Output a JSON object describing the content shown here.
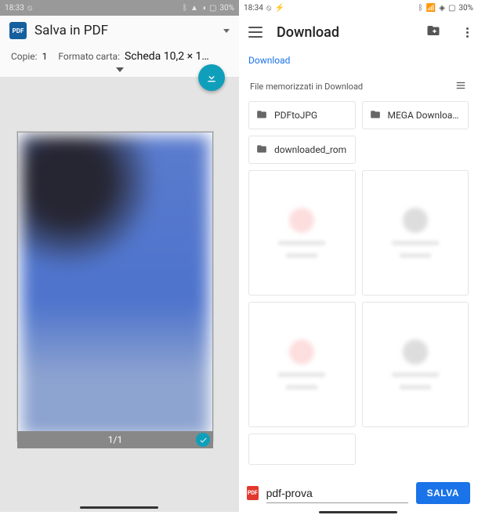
{
  "left": {
    "status": {
      "time": "18:33",
      "battery": "30%"
    },
    "header": {
      "badge": "PDF",
      "title": "Salva in PDF"
    },
    "options": {
      "copies_label": "Copie:",
      "copies_value": "1",
      "format_label": "Formato carta:",
      "format_value": "Scheda 10,2 × 1…"
    },
    "page_indicator": "1/1"
  },
  "right": {
    "status": {
      "time": "18:34",
      "battery": "30%"
    },
    "titlebar": {
      "title": "Download"
    },
    "breadcrumb": "Download",
    "section_label": "File memorizzati in Download",
    "folders": [
      {
        "label": "PDFtoJPG"
      },
      {
        "label": "MEGA Downloa…"
      },
      {
        "label": "downloaded_rom"
      }
    ],
    "save": {
      "badge": "PDF",
      "filename": "pdf-prova",
      "button": "SALVA"
    }
  }
}
